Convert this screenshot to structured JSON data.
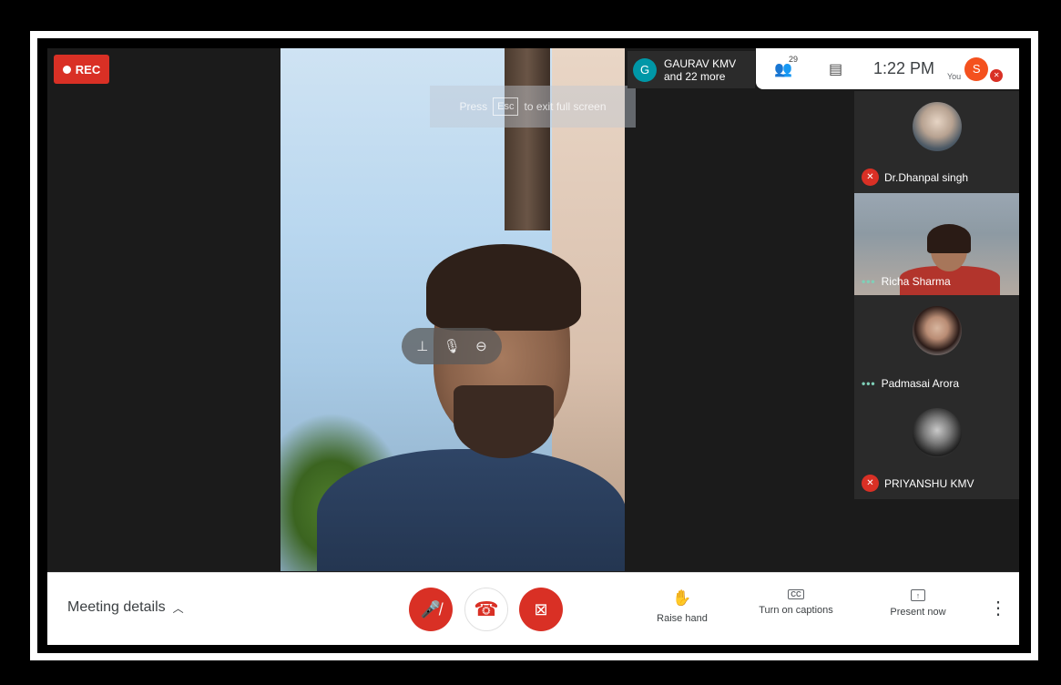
{
  "recording": {
    "label": "REC"
  },
  "fullscreen_hint": {
    "press": "Press",
    "key": "Esc",
    "suffix": "to exit full screen"
  },
  "presenting": {
    "initial": "G",
    "name": "GAURAV KMV",
    "more": "and 22 more"
  },
  "topbar": {
    "participants_count": "29",
    "time": "1:22 PM",
    "you_label": "You",
    "avatar_initial": "S"
  },
  "participants": [
    {
      "name": "Dr.Dhanpal singh",
      "status": "muted"
    },
    {
      "name": "Richa Sharma",
      "status": "speaking-dots"
    },
    {
      "name": "Padmasai Arora",
      "status": "speaking-dots"
    },
    {
      "name": "PRIYANSHU KMV",
      "status": "muted"
    }
  ],
  "bottombar": {
    "meeting_details": "Meeting details",
    "raise_hand": "Raise hand",
    "captions": "Turn on captions",
    "captions_icon": "CC",
    "present": "Present now"
  },
  "icons": {
    "mic_off": "mic-off-icon",
    "hangup": "hangup-icon",
    "camera_off": "camera-off-icon",
    "pin": "pin-icon",
    "people": "people-icon",
    "chat": "chat-icon",
    "hand": "hand-icon",
    "more": "more-vert-icon"
  },
  "colors": {
    "red": "#d93025",
    "teal_avatar": "#0097a7",
    "orange_avatar": "#f4511e"
  }
}
